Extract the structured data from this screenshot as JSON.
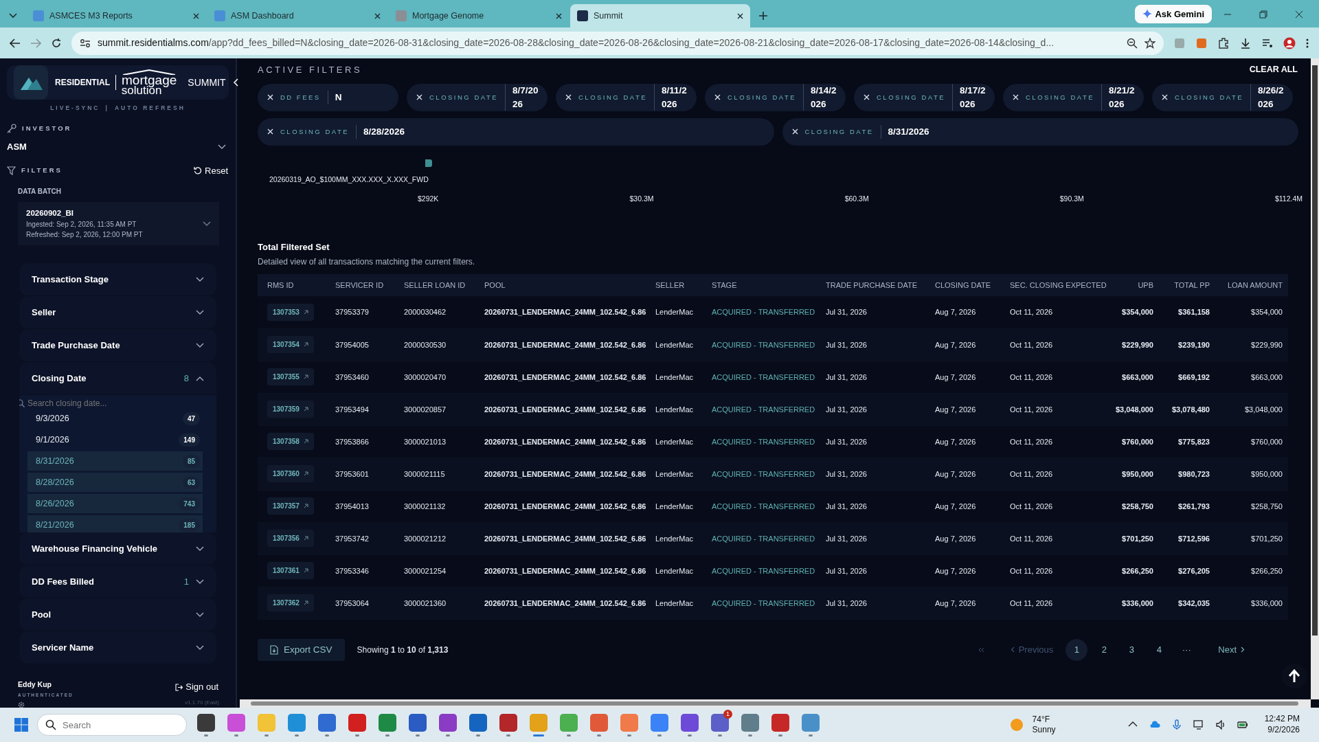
{
  "browser": {
    "tabs": [
      {
        "title": "ASMCES M3 Reports",
        "selected": false
      },
      {
        "title": "ASM Dashboard",
        "selected": false
      },
      {
        "title": "Mortgage Genome",
        "selected": false
      },
      {
        "title": "Summit",
        "selected": true
      }
    ],
    "gemini": "Ask Gemini",
    "url_host": "summit.residentialms.com",
    "url_path": "/app?dd_fees_billed=N&closing_date=2026-08-31&closing_date=2026-08-28&closing_date=2026-08-26&closing_date=2026-08-21&closing_date=2026-08-17&closing_date=2026-08-14&closing_d..."
  },
  "sidebar": {
    "brand": {
      "left": "RESIDENTIAL",
      "right": "mortgage",
      "sub": "solution",
      "app": "SUMMIT"
    },
    "sync": [
      "LIVE-SYNC",
      "|",
      "AUTO REFRESH"
    ],
    "investor": {
      "label": "INVESTOR",
      "value": "ASM"
    },
    "filters_label": "FILTERS",
    "reset": "Reset",
    "data_batch": {
      "label": "DATA BATCH",
      "name": "20260902_BI",
      "ingested": "Ingested: Sep 2, 2026, 11:35 AM PT",
      "refreshed": "Refreshed: Sep 2, 2026, 12:00 PM PT"
    },
    "filter_groups": [
      {
        "title": "Transaction Stage",
        "expanded": false
      },
      {
        "title": "Seller",
        "expanded": false
      },
      {
        "title": "Trade Purchase Date",
        "expanded": false
      },
      {
        "title": "Closing Date",
        "count": "8",
        "expanded": true,
        "search_placeholder": "Search closing date...",
        "options": [
          {
            "label": "9/3/2026",
            "count": "47",
            "selected": false
          },
          {
            "label": "9/1/2026",
            "count": "149",
            "selected": false
          },
          {
            "label": "8/31/2026",
            "count": "85",
            "selected": true
          },
          {
            "label": "8/28/2026",
            "count": "63",
            "selected": true
          },
          {
            "label": "8/26/2026",
            "count": "743",
            "selected": true
          },
          {
            "label": "8/21/2026",
            "count": "185",
            "selected": true
          }
        ]
      },
      {
        "title": "Warehouse Financing Vehicle",
        "expanded": false
      },
      {
        "title": "DD Fees Billed",
        "count": "1",
        "expanded": false
      },
      {
        "title": "Pool",
        "expanded": false
      },
      {
        "title": "Servicer Name",
        "expanded": false
      }
    ],
    "user": {
      "name": "Eddy Kup",
      "status": "AUTHENTICATED"
    },
    "sign_out": "Sign out",
    "version": "v1.1.70 (East)"
  },
  "main": {
    "active_filters": {
      "title": "ACTIVE FILTERS",
      "clear_all": "CLEAR ALL",
      "chips": [
        {
          "label": "DD FEES",
          "value": "N"
        },
        {
          "label": "CLOSING DATE",
          "value": "8/7/2026"
        },
        {
          "label": "CLOSING DATE",
          "value": "8/11/2026"
        },
        {
          "label": "CLOSING DATE",
          "value": "8/14/2026"
        },
        {
          "label": "CLOSING DATE",
          "value": "8/17/2026"
        },
        {
          "label": "CLOSING DATE",
          "value": "8/21/2026"
        },
        {
          "label": "CLOSING DATE",
          "value": "8/26/2026"
        },
        {
          "label": "CLOSING DATE",
          "value": "8/28/2026"
        },
        {
          "label": "CLOSING DATE",
          "value": "8/31/2026"
        }
      ]
    },
    "chart_fragment": {
      "row_label": "20260319_AO_$100MM_XXX.XXX_X.XXX_FWD",
      "ticks": [
        "$292K",
        "$30.3M",
        "$60.3M",
        "$90.3M",
        "$112.4M"
      ]
    },
    "table": {
      "title": "Total Filtered Set",
      "subtitle": "Detailed view of all transactions matching the current filters.",
      "columns": [
        {
          "label": "RMS ID",
          "kind": "link"
        },
        {
          "label": "SERVICER ID",
          "kind": "text"
        },
        {
          "label": "SELLER LOAN ID",
          "kind": "text"
        },
        {
          "label": "POOL",
          "kind": "bold"
        },
        {
          "label": "SELLER",
          "kind": "text"
        },
        {
          "label": "STAGE",
          "kind": "stage"
        },
        {
          "label": "TRADE PURCHASE DATE",
          "kind": "text"
        },
        {
          "label": "CLOSING DATE",
          "kind": "text"
        },
        {
          "label": "SEC. CLOSING EXPECTED",
          "kind": "text"
        },
        {
          "label": "UPB",
          "kind": "money_bold"
        },
        {
          "label": "TOTAL PP",
          "kind": "money_bold"
        },
        {
          "label": "LOAN AMOUNT",
          "kind": "money"
        }
      ],
      "rows": [
        [
          "1307353",
          "37953379",
          "2000030462",
          "20260731_LENDERMAC_24MM_102.542_6.86",
          "LenderMac",
          "ACQUIRED - TRANSFERRED",
          "Jul 31, 2026",
          "Aug 7, 2026",
          "Oct 11, 2026",
          "$354,000",
          "$361,158",
          "$354,000"
        ],
        [
          "1307354",
          "37954005",
          "2000030530",
          "20260731_LENDERMAC_24MM_102.542_6.86",
          "LenderMac",
          "ACQUIRED - TRANSFERRED",
          "Jul 31, 2026",
          "Aug 7, 2026",
          "Oct 11, 2026",
          "$229,990",
          "$239,190",
          "$229,990"
        ],
        [
          "1307355",
          "37953460",
          "3000020470",
          "20260731_LENDERMAC_24MM_102.542_6.86",
          "LenderMac",
          "ACQUIRED - TRANSFERRED",
          "Jul 31, 2026",
          "Aug 7, 2026",
          "Oct 11, 2026",
          "$663,000",
          "$669,192",
          "$663,000"
        ],
        [
          "1307359",
          "37953494",
          "3000020857",
          "20260731_LENDERMAC_24MM_102.542_6.86",
          "LenderMac",
          "ACQUIRED - TRANSFERRED",
          "Jul 31, 2026",
          "Aug 7, 2026",
          "Oct 11, 2026",
          "$3,048,000",
          "$3,078,480",
          "$3,048,000"
        ],
        [
          "1307358",
          "37953866",
          "3000021013",
          "20260731_LENDERMAC_24MM_102.542_6.86",
          "LenderMac",
          "ACQUIRED - TRANSFERRED",
          "Jul 31, 2026",
          "Aug 7, 2026",
          "Oct 11, 2026",
          "$760,000",
          "$775,823",
          "$760,000"
        ],
        [
          "1307360",
          "37953601",
          "3000021115",
          "20260731_LENDERMAC_24MM_102.542_6.86",
          "LenderMac",
          "ACQUIRED - TRANSFERRED",
          "Jul 31, 2026",
          "Aug 7, 2026",
          "Oct 11, 2026",
          "$950,000",
          "$980,723",
          "$950,000"
        ],
        [
          "1307357",
          "37954013",
          "3000021132",
          "20260731_LENDERMAC_24MM_102.542_6.86",
          "LenderMac",
          "ACQUIRED - TRANSFERRED",
          "Jul 31, 2026",
          "Aug 7, 2026",
          "Oct 11, 2026",
          "$258,750",
          "$261,793",
          "$258,750"
        ],
        [
          "1307356",
          "37953742",
          "3000021212",
          "20260731_LENDERMAC_24MM_102.542_6.86",
          "LenderMac",
          "ACQUIRED - TRANSFERRED",
          "Jul 31, 2026",
          "Aug 7, 2026",
          "Oct 11, 2026",
          "$701,250",
          "$712,596",
          "$701,250"
        ],
        [
          "1307361",
          "37953346",
          "3000021254",
          "20260731_LENDERMAC_24MM_102.542_6.86",
          "LenderMac",
          "ACQUIRED - TRANSFERRED",
          "Jul 31, 2026",
          "Aug 7, 2026",
          "Oct 11, 2026",
          "$266,250",
          "$276,205",
          "$266,250"
        ],
        [
          "1307362",
          "37953064",
          "3000021360",
          "20260731_LENDERMAC_24MM_102.542_6.86",
          "LenderMac",
          "ACQUIRED - TRANSFERRED",
          "Jul 31, 2026",
          "Aug 7, 2026",
          "Oct 11, 2026",
          "$336,000",
          "$342,035",
          "$336,000"
        ]
      ]
    },
    "pagination": {
      "export": "Export CSV",
      "showing": "Showing **1** to **10** of **1,313**",
      "previous": "Previous",
      "next": "Next",
      "pages": [
        {
          "label": "1",
          "selected": true
        },
        {
          "label": "2",
          "selected": false
        },
        {
          "label": "3",
          "selected": false
        },
        {
          "label": "4",
          "selected": false
        },
        {
          "label": "···",
          "selected": false
        }
      ]
    }
  },
  "taskbar": {
    "search_placeholder": "Search",
    "apps": [
      {
        "color": "#3a3a3a"
      },
      {
        "color": "#c94fd6"
      },
      {
        "color": "#f2c237"
      },
      {
        "color": "#1f8fd8"
      },
      {
        "color": "#2f6bd1"
      },
      {
        "color": "#d21f1f"
      },
      {
        "color": "#1e8a45"
      },
      {
        "color": "#2b5cc4"
      },
      {
        "color": "#8a3cc4"
      },
      {
        "color": "#1565c0"
      },
      {
        "color": "#b3262a"
      },
      {
        "color": "#e3a21a",
        "selected": true
      },
      {
        "color": "#4caf50"
      },
      {
        "color": "#e05a3a"
      },
      {
        "color": "#f07a4a"
      },
      {
        "color": "#3b82f6"
      },
      {
        "color": "#6d4bd8"
      },
      {
        "color": "#5b5fc7",
        "badge": "1"
      },
      {
        "color": "#607d8b"
      },
      {
        "color": "#c62828"
      },
      {
        "color": "#4a90c8"
      }
    ],
    "weather_temp": "74°F",
    "weather_text": "Sunny",
    "time": "12:42 PM",
    "date": "9/2/2026"
  }
}
